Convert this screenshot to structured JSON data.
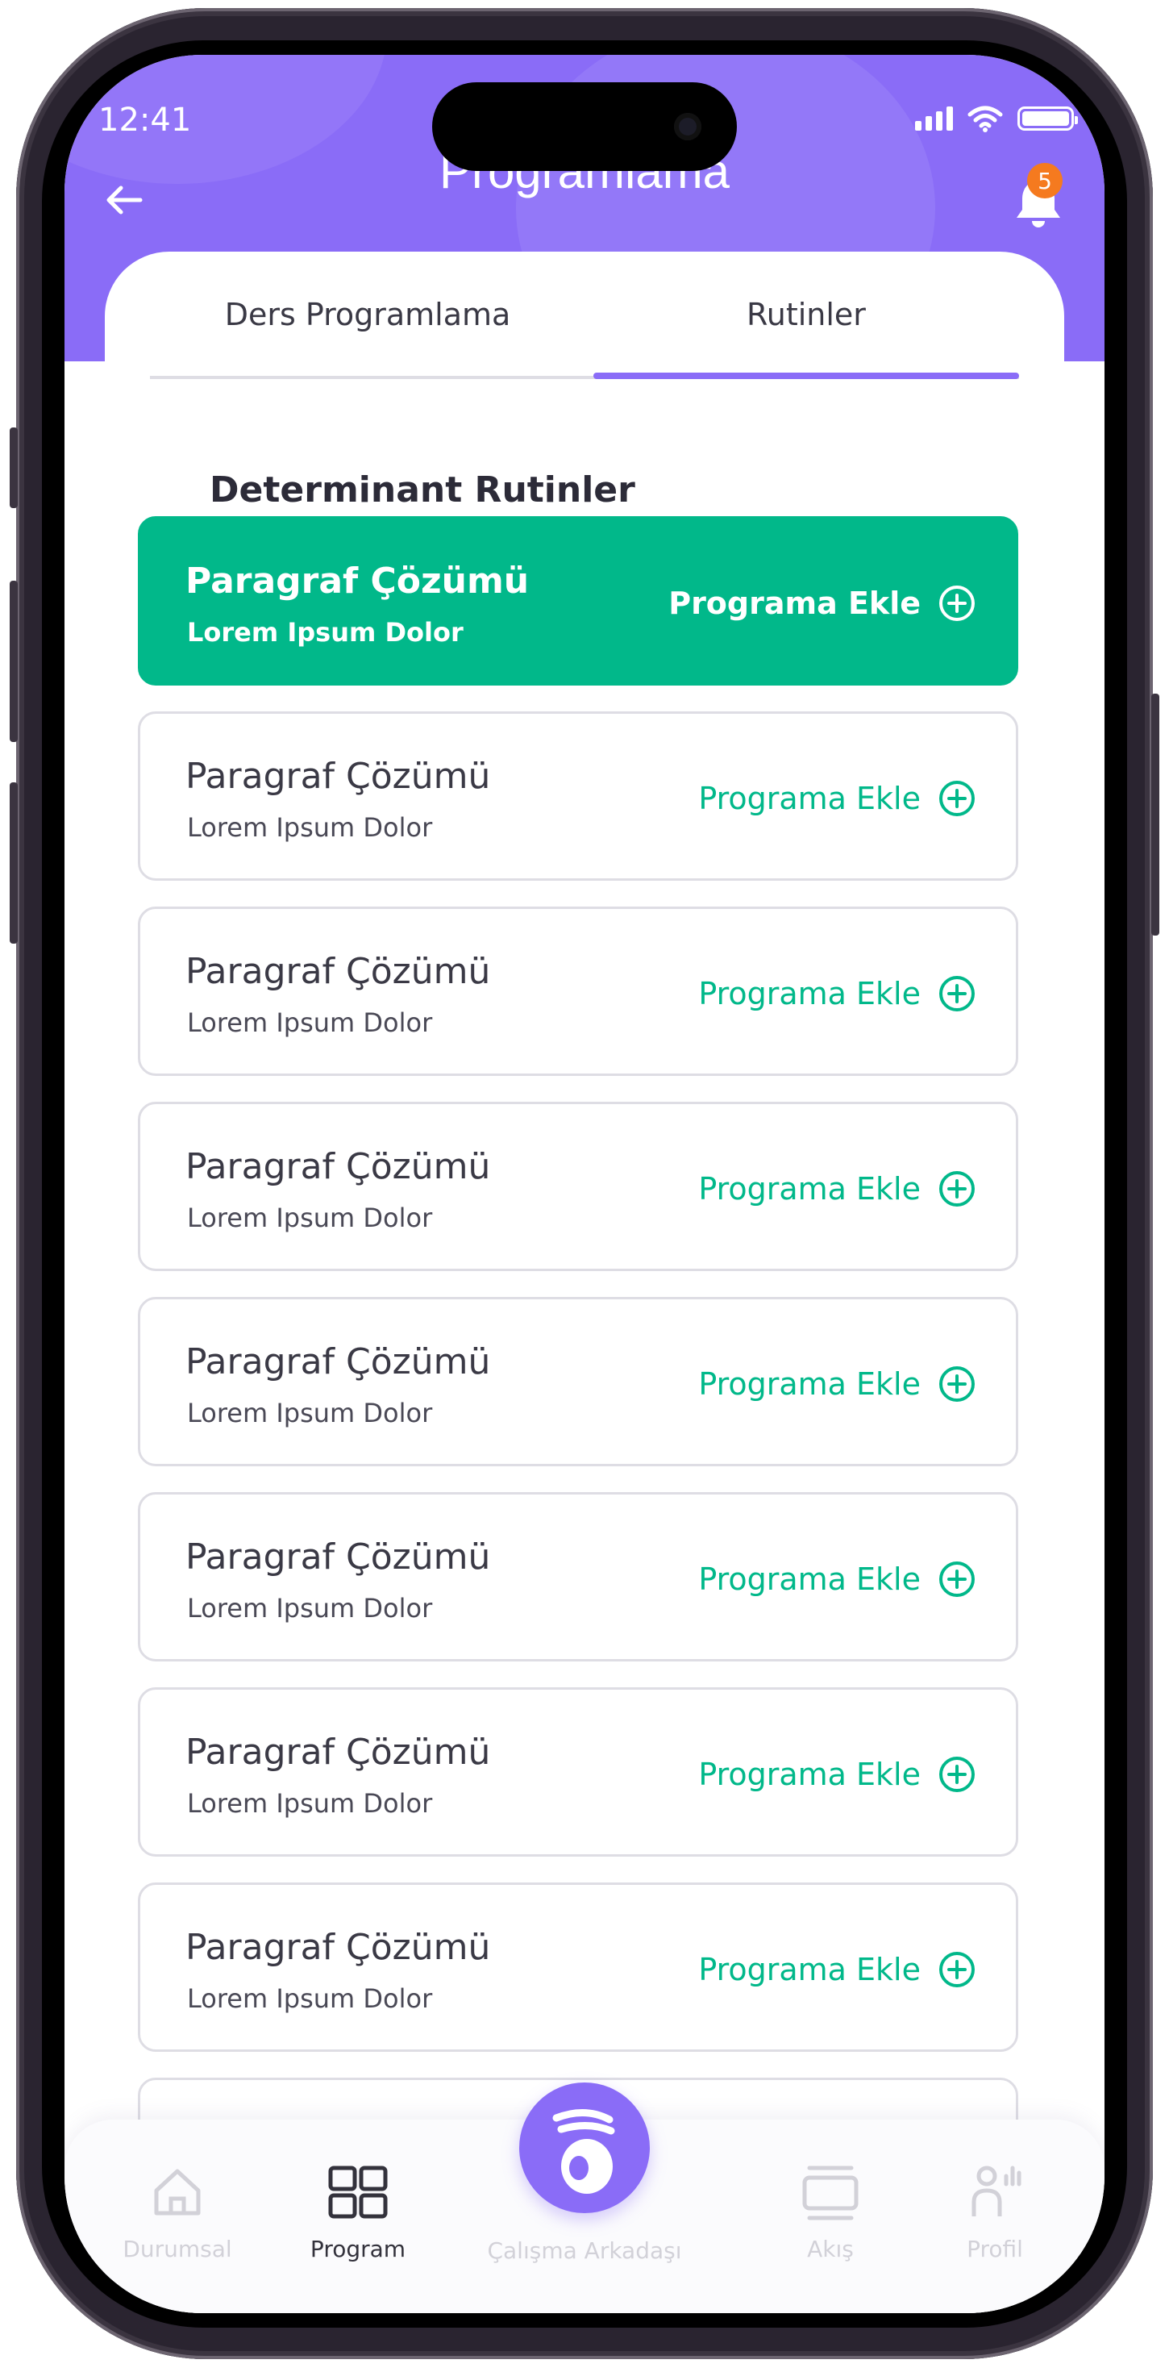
{
  "status_bar": {
    "time": "12:41"
  },
  "header": {
    "title": "Programlama",
    "notification_count": "5"
  },
  "tabs": [
    {
      "label": "Ders Programlama",
      "active": false
    },
    {
      "label": "Rutinler",
      "active": true
    }
  ],
  "section": {
    "title": "Determinant Rutinler"
  },
  "routines": [
    {
      "title": "Paragraf Çözümü",
      "subtitle": "Lorem Ipsum Dolor",
      "action": "Programa Ekle",
      "selected": true
    },
    {
      "title": "Paragraf Çözümü",
      "subtitle": "Lorem Ipsum Dolor",
      "action": "Programa Ekle",
      "selected": false
    },
    {
      "title": "Paragraf Çözümü",
      "subtitle": "Lorem Ipsum Dolor",
      "action": "Programa Ekle",
      "selected": false
    },
    {
      "title": "Paragraf Çözümü",
      "subtitle": "Lorem Ipsum Dolor",
      "action": "Programa Ekle",
      "selected": false
    },
    {
      "title": "Paragraf Çözümü",
      "subtitle": "Lorem Ipsum Dolor",
      "action": "Programa Ekle",
      "selected": false
    },
    {
      "title": "Paragraf Çözümü",
      "subtitle": "Lorem Ipsum Dolor",
      "action": "Programa Ekle",
      "selected": false
    },
    {
      "title": "Paragraf Çözümü",
      "subtitle": "Lorem Ipsum Dolor",
      "action": "Programa Ekle",
      "selected": false
    },
    {
      "title": "Paragraf Çözümü",
      "subtitle": "Lorem Ipsum Dolor",
      "action": "Programa Ekle",
      "selected": false
    }
  ],
  "bottom_nav": {
    "items": [
      {
        "label": "Durumsal",
        "icon": "home-icon",
        "active": false
      },
      {
        "label": "Program",
        "icon": "grid-icon",
        "active": true
      },
      {
        "label": "Çalışma Arkadaşı",
        "icon": "bunny-icon",
        "active": false
      },
      {
        "label": "Akış",
        "icon": "stack-icon",
        "active": false
      },
      {
        "label": "Profil",
        "icon": "profile-icon",
        "active": false
      }
    ]
  },
  "colors": {
    "brand_purple": "#8a6cf7",
    "accent_green": "#01b88a",
    "badge_orange": "#f57a1f",
    "border_grey": "#dedde4"
  }
}
